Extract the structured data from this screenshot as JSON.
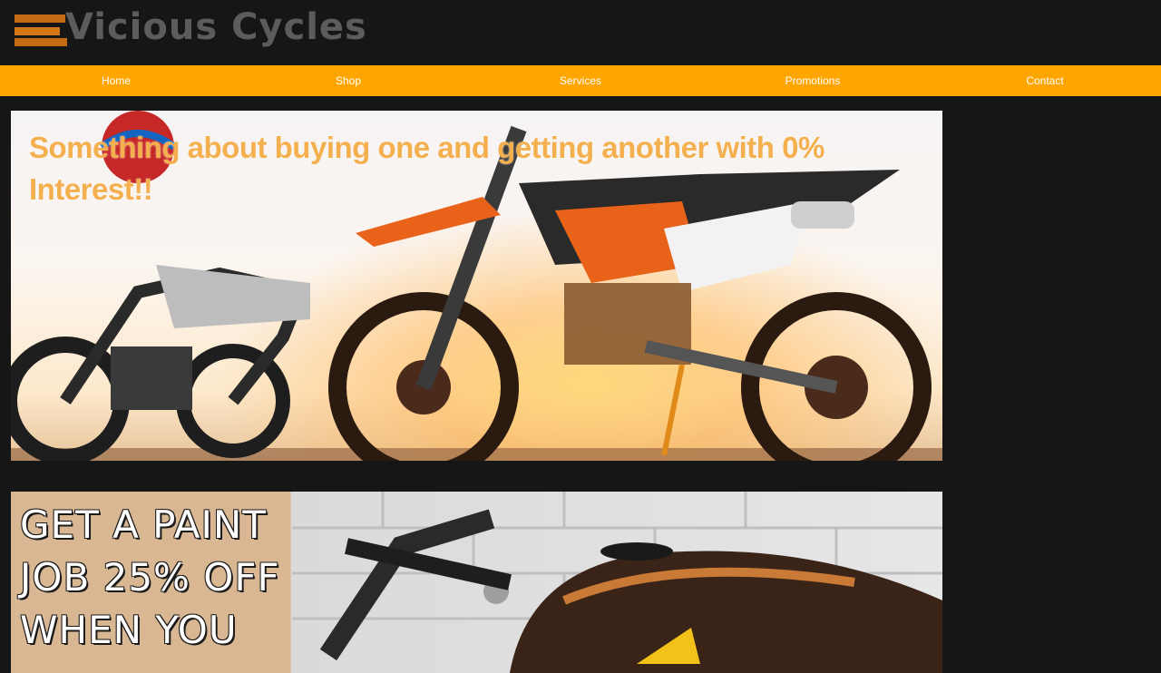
{
  "header": {
    "logo_text": "Vicious Cycles"
  },
  "nav": {
    "items": [
      {
        "label": "Home"
      },
      {
        "label": "Shop"
      },
      {
        "label": "Services"
      },
      {
        "label": "Promotions"
      },
      {
        "label": "Contact"
      }
    ]
  },
  "promotions": [
    {
      "text": "Something about buying one and getting another with  0% Interest!!"
    },
    {
      "text": "GET A PAINT JOB 25% OFF WHEN YOU"
    }
  ],
  "colors": {
    "background": "#161616",
    "nav": "#ffa500",
    "logo_accent": "#c46a12",
    "logo_text": "#5c5c5c",
    "promo_orange": "#f4b04e"
  }
}
